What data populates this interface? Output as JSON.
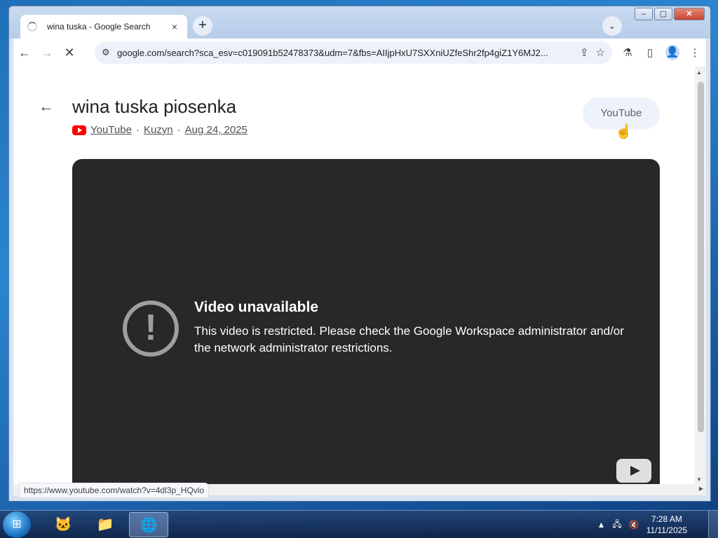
{
  "browser": {
    "tab_title": "wina tuska - Google Search",
    "tab_close": "×",
    "new_tab": "+",
    "tab_search": "⌄",
    "window_min": "–",
    "window_max": "▢",
    "window_close": "✕",
    "url": "google.com/search?sca_esv=c019091b52478373&udm=7&fbs=AIIjpHxU7SXXniUZfeShr2fp4giZ1Y6MJ2...",
    "status_url": "https://www.youtube.com/watch?v=4dl3p_HQvlo"
  },
  "video": {
    "title": "wina tuska piosenka",
    "source": "YouTube",
    "channel": "Kuzyn",
    "date": "Aug 24, 2025",
    "separator": "·",
    "chip_label": "YouTube",
    "unavailable_title": "Video unavailable",
    "unavailable_message": "This video is restricted. Please check the Google Workspace administrator and/or the network administrator restrictions."
  },
  "taskbar": {
    "time": "7:28 AM",
    "date": "11/11/2025"
  },
  "colors": {
    "accent": "#1a73e8",
    "player_bg": "#282828",
    "youtube_red": "#ff0000"
  },
  "icons": {
    "back": "←",
    "forward": "→",
    "reload": "✕",
    "site_info": "⚙",
    "share": "⇪",
    "star": "☆",
    "labs": "⚗",
    "sidepanel": "▯",
    "profile": "👤",
    "menu": "⋮",
    "warning": "!",
    "cursor": "☝"
  }
}
